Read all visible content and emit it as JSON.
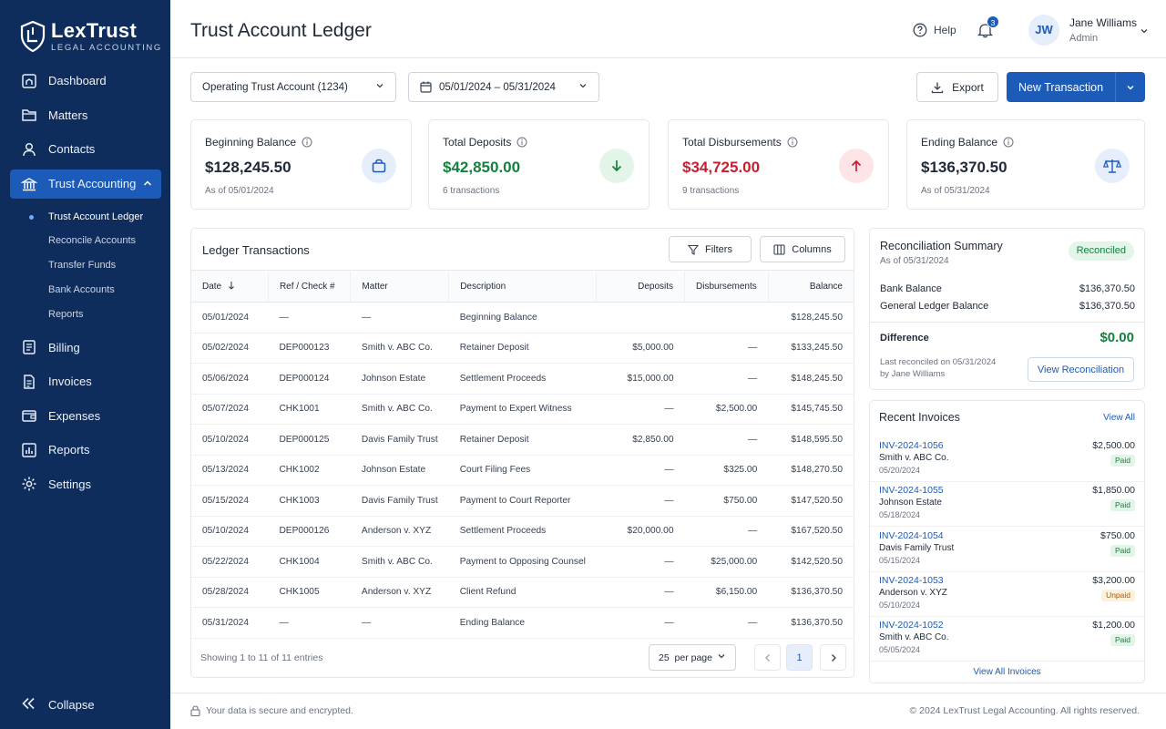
{
  "brand": {
    "name": "LexTrust",
    "tagline": "LEGAL ACCOUNTING"
  },
  "sidebar": {
    "items": [
      {
        "label": "Dashboard",
        "icon": "home-icon"
      },
      {
        "label": "Matters",
        "icon": "folder-icon"
      },
      {
        "label": "Contacts",
        "icon": "person-icon"
      },
      {
        "label": "Trust Accounting",
        "icon": "bank-icon",
        "active": true
      },
      {
        "label": "Billing",
        "icon": "billing-icon"
      },
      {
        "label": "Invoices",
        "icon": "invoice-icon"
      },
      {
        "label": "Expenses",
        "icon": "wallet-icon"
      },
      {
        "label": "Reports",
        "icon": "chart-icon"
      },
      {
        "label": "Settings",
        "icon": "gear-icon"
      }
    ],
    "subitems": [
      {
        "label": "Trust Account Ledger",
        "current": true
      },
      {
        "label": "Reconcile Accounts"
      },
      {
        "label": "Transfer Funds"
      },
      {
        "label": "Bank Accounts"
      },
      {
        "label": "Reports"
      }
    ],
    "collapse_label": "Collapse"
  },
  "header": {
    "title": "Trust Account Ledger",
    "help_label": "Help",
    "notification_count": "3",
    "user": {
      "initials": "JW",
      "name": "Jane Williams",
      "role": "Admin"
    }
  },
  "toolbar": {
    "account_select": "Operating Trust Account (1234)",
    "date_range": "05/01/2024 – 05/31/2024",
    "export_label": "Export",
    "new_label": "New Transaction"
  },
  "stats": [
    {
      "label": "Beginning Balance",
      "value": "$128,245.50",
      "sub": "As of 05/01/2024",
      "icon": "bag-icon",
      "tone": "neutral"
    },
    {
      "label": "Total Deposits",
      "value": "$42,850.00",
      "sub": "6 transactions",
      "icon": "arrow-down-icon",
      "tone": "positive"
    },
    {
      "label": "Total Disbursements",
      "value": "$34,725.00",
      "sub": "9 transactions",
      "icon": "arrow-up-icon",
      "tone": "negative"
    },
    {
      "label": "Ending Balance",
      "value": "$136,370.50",
      "sub": "As of 05/31/2024",
      "icon": "scale-icon",
      "tone": "neutral"
    }
  ],
  "colors": {
    "accent": "#1d5bb8",
    "sidebar": "#0f2d5c",
    "positive": "#15803d",
    "negative": "#c81e2e"
  },
  "ledger": {
    "title": "Ledger Transactions",
    "filters_label": "Filters",
    "columns_label": "Columns",
    "headers": [
      "Date",
      "Ref / Check #",
      "Matter",
      "Description",
      "Deposits",
      "Disbursements",
      "Balance"
    ],
    "rows": [
      [
        "05/01/2024",
        "—",
        "—",
        "Beginning Balance",
        "",
        "",
        "$128,245.50"
      ],
      [
        "05/02/2024",
        "DEP000123",
        "Smith v. ABC Co.",
        "Retainer Deposit",
        "$5,000.00",
        "—",
        "$133,245.50"
      ],
      [
        "05/06/2024",
        "DEP000124",
        "Johnson Estate",
        "Settlement Proceeds",
        "$15,000.00",
        "—",
        "$148,245.50"
      ],
      [
        "05/07/2024",
        "CHK1001",
        "Smith v. ABC Co.",
        "Payment to Expert Witness",
        "—",
        "$2,500.00",
        "$145,745.50"
      ],
      [
        "05/10/2024",
        "DEP000125",
        "Davis Family Trust",
        "Retainer Deposit",
        "$2,850.00",
        "—",
        "$148,595.50"
      ],
      [
        "05/13/2024",
        "CHK1002",
        "Johnson Estate",
        "Court Filing Fees",
        "—",
        "$325.00",
        "$148,270.50"
      ],
      [
        "05/15/2024",
        "CHK1003",
        "Davis Family Trust",
        "Payment to Court Reporter",
        "—",
        "$750.00",
        "$147,520.50"
      ],
      [
        "05/10/2024",
        "DEP000126",
        "Anderson v. XYZ",
        "Settlement Proceeds",
        "$20,000.00",
        "—",
        "$167,520.50"
      ],
      [
        "05/22/2024",
        "CHK1004",
        "Smith v. ABC Co.",
        "Payment to Opposing Counsel",
        "—",
        "$25,000.00",
        "$142,520.50"
      ],
      [
        "05/28/2024",
        "CHK1005",
        "Anderson v. XYZ",
        "Client Refund",
        "—",
        "$6,150.00",
        "$136,370.50"
      ],
      [
        "05/31/2024",
        "—",
        "—",
        "Ending Balance",
        "—",
        "—",
        "$136,370.50"
      ]
    ],
    "footer_text": "Showing 1 to 11 of 11 entries",
    "per_page": "25  per page",
    "current_page": "1"
  },
  "reconciliation": {
    "title": "Reconciliation Summary",
    "as_of": "As of 05/31/2024",
    "status": "Reconciled",
    "bank_label": "Bank Balance",
    "bank_value": "$136,370.50",
    "gl_label": "General Ledger Balance",
    "gl_value": "$136,370.50",
    "diff_label": "Difference",
    "diff_value": "$0.00",
    "last_line1": "Last reconciled on 05/31/2024",
    "last_line2": "by Jane Williams",
    "button": "View Reconciliation"
  },
  "invoices": {
    "title": "Recent Invoices",
    "view_all": "View All",
    "items": [
      {
        "id": "INV-2024-1056",
        "client": "Smith v. ABC Co.",
        "date": "05/20/2024",
        "amount": "$2,500.00",
        "status": "Paid"
      },
      {
        "id": "INV-2024-1055",
        "client": "Johnson Estate",
        "date": "05/18/2024",
        "amount": "$1,850.00",
        "status": "Paid"
      },
      {
        "id": "INV-2024-1054",
        "client": "Davis Family Trust",
        "date": "05/15/2024",
        "amount": "$750.00",
        "status": "Paid"
      },
      {
        "id": "INV-2024-1053",
        "client": "Anderson v. XYZ",
        "date": "05/10/2024",
        "amount": "$3,200.00",
        "status": "Unpaid"
      },
      {
        "id": "INV-2024-1052",
        "client": "Smith v. ABC Co.",
        "date": "05/05/2024",
        "amount": "$1,200.00",
        "status": "Paid"
      }
    ],
    "view_all_invoices": "View All Invoices"
  },
  "footer": {
    "secure": "Your data is secure and encrypted.",
    "copyright": "© 2024 LexTrust Legal Accounting. All rights reserved."
  }
}
